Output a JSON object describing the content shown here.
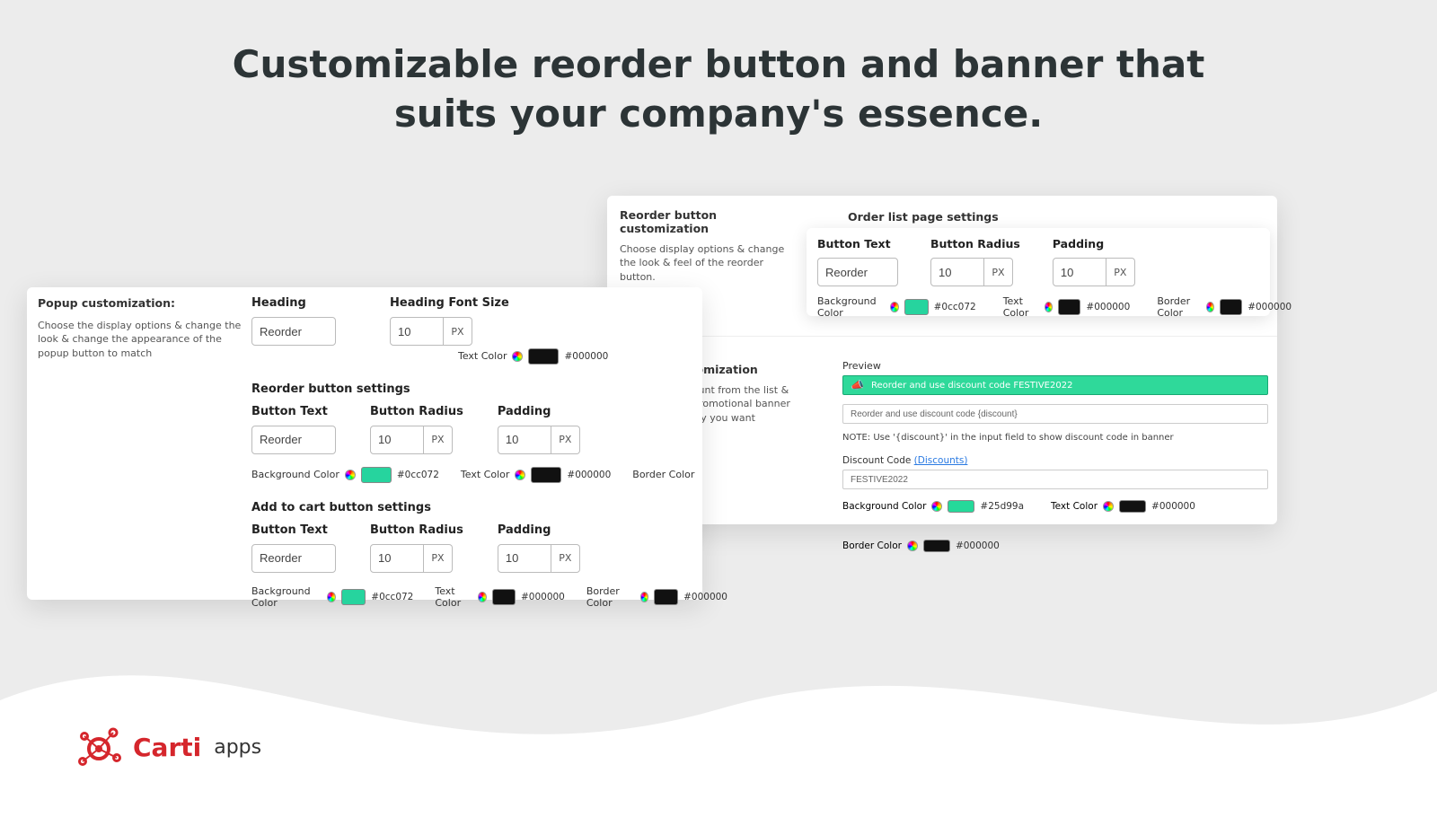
{
  "headline_line1": "Customizable reorder button and banner that",
  "headline_line2": "suits your company's essence.",
  "brand": {
    "name": "Carti",
    "sub": "apps"
  },
  "popup": {
    "title": "Popup customization:",
    "desc": "Choose the display options & change the look & change the appearance of the popup button to match",
    "heading_label": "Heading",
    "heading_value": "Reorder",
    "font_size_label": "Heading Font Size",
    "font_size_value": "10",
    "px": "PX",
    "text_color_label": "Text Color",
    "text_color_hex": "#000000",
    "reorder_section": "Reorder button settings",
    "addcart_section": "Add to cart button settings",
    "btn_text_label": "Button Text",
    "btn_text_value": "Reorder",
    "btn_radius_label": "Button Radius",
    "btn_radius_value": "10",
    "padding_label": "Padding",
    "padding_value": "10",
    "bg_label": "Background Color",
    "bg_hex": "#0cc072",
    "tc_label": "Text Color",
    "tc_hex": "#000000",
    "bc_label": "Border Color",
    "bc_hex": "#000000"
  },
  "orderlist": {
    "left_title": "Reorder button customization",
    "left_desc": "Choose display options & change the look & feel of the reorder button.",
    "right_title": "Order list page settings",
    "btn_text_label": "Button Text",
    "btn_text_value": "Reorder",
    "btn_radius_label": "Button Radius",
    "btn_radius_value": "10",
    "padding_label": "Padding",
    "padding_value": "10",
    "px": "PX",
    "bg_label": "Background Color",
    "bg_hex": "#0cc072",
    "tc_label": "Text Color",
    "tc_hex": "#000000",
    "bc_label": "Border Color",
    "bc_hex": "#000000"
  },
  "banner": {
    "left_title": "Banner customization",
    "left_desc": "Select the discount from the list & customize the promotional banner message the way you want",
    "preview_label": "Preview",
    "preview_text": "Reorder and use discount code FESTIVE2022",
    "template_value": "Reorder and use discount code {discount}",
    "note": "NOTE: Use '{discount}' in the input field to show discount code in banner",
    "dc_label": "Discount Code",
    "dc_link": "(Discounts)",
    "dc_value": "FESTIVE2022",
    "bg_label": "Background Color",
    "bg_hex": "#25d99a",
    "tc_label": "Text Color",
    "tc_hex": "#000000",
    "bc_label": "Border Color",
    "bc_hex": "#000000"
  }
}
